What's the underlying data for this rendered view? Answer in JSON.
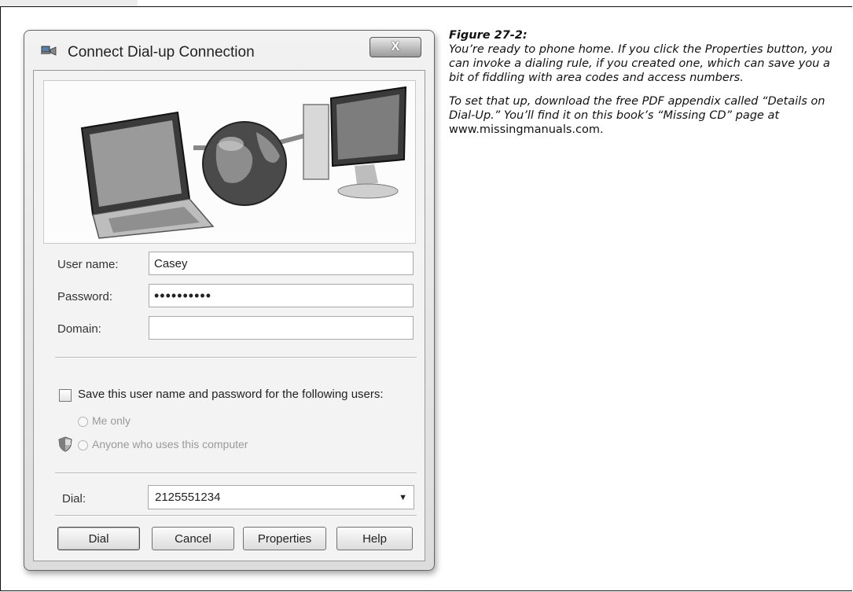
{
  "window": {
    "title": "Connect Dial-up Connection",
    "close_label": "X"
  },
  "form": {
    "username_label": "User name:",
    "username_value": "Casey",
    "password_label": "Password:",
    "password_value": "••••••••••",
    "domain_label": "Domain:",
    "domain_value": "",
    "save_checkbox_label": "Save this user name and password for the following users:",
    "radio_me_only": "Me only",
    "radio_anyone": "Anyone who uses this computer",
    "dial_label": "Dial:",
    "dial_value": "2125551234"
  },
  "buttons": {
    "dial": "Dial",
    "cancel": "Cancel",
    "properties": "Properties",
    "help": "Help"
  },
  "caption": {
    "title": "Figure 27-2:",
    "para1": "You’re ready to phone home. If you click the Properties button, you can invoke a dialing rule, if you created one, which can save you a bit of fiddling with area codes and access numbers.",
    "para2_prefix": "To set that up, download the free PDF appendix called “Details on Dial-Up.” You’ll find it on this book’s “Missing CD” page at",
    "para2_url": "www.missingmanuals.com."
  },
  "icons": [
    "dialup-connection-icon",
    "close-icon",
    "laptop-icon",
    "globe-icon",
    "desktop-computer-icon",
    "shield-icon",
    "dropdown-arrow-icon"
  ],
  "colors": {
    "window_bg": "#e6e6e6",
    "close_button": "#9a9a9a",
    "text": "#222222"
  }
}
